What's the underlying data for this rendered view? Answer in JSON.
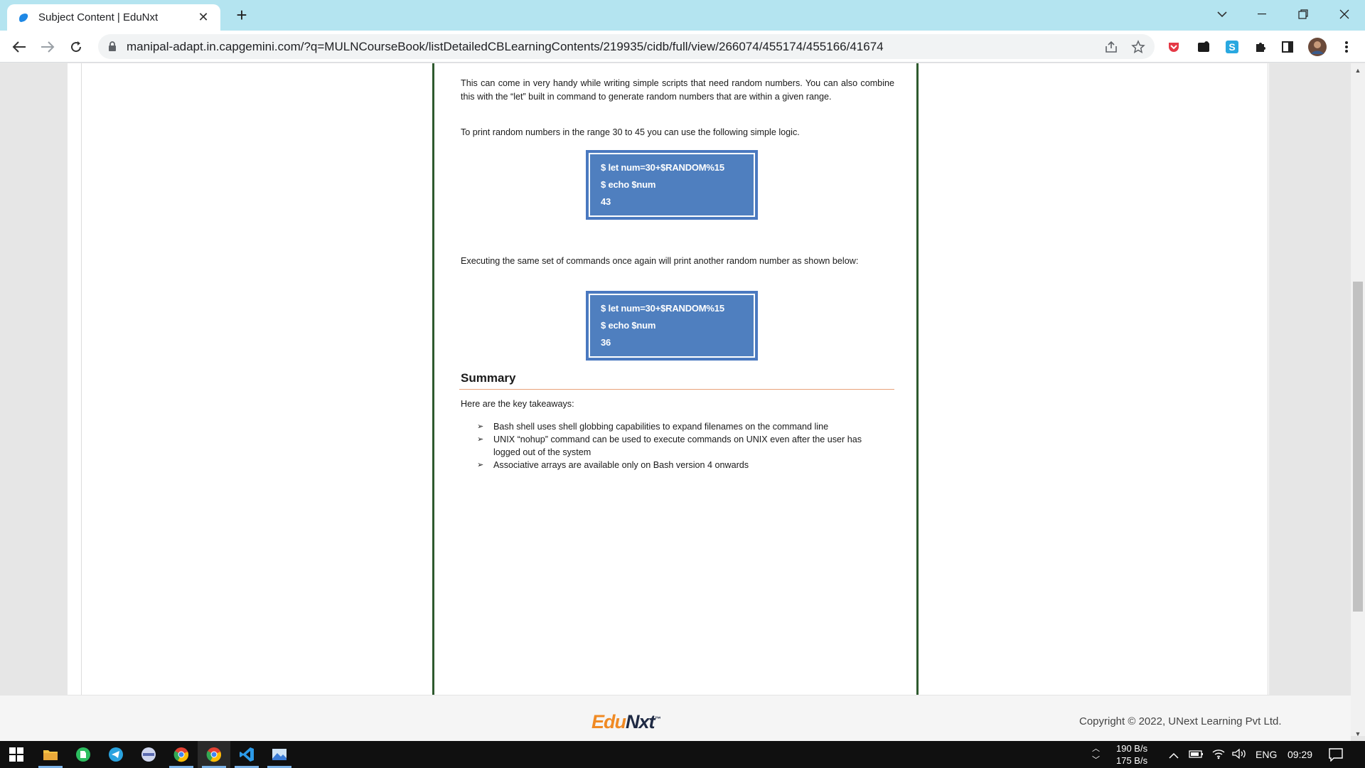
{
  "browser": {
    "tab_title": "Subject Content | EduNxt",
    "url": "manipal-adapt.in.capgemini.com/?q=MULNCourseBook/listDetailedCBLearningContents/219935/cidb/full/view/266074/455174/455166/41674"
  },
  "document": {
    "para1": "This can come in very handy while writing simple scripts that need random numbers. You can also combine this with the “let” built in command to generate random numbers that are within a given range.",
    "para2": "To print random numbers in the range 30 to 45 you can use the following simple logic.",
    "code1": [
      "$ let num=30+$RANDOM%15",
      "$ echo $num",
      "43"
    ],
    "para3": "Executing the same set of commands once again will print another random number as shown below:",
    "code2": [
      "$ let num=30+$RANDOM%15",
      "$ echo $num",
      "36"
    ],
    "summary_heading": "Summary",
    "summary_intro": "Here are the key takeaways:",
    "bullets": [
      "Bash shell uses shell globbing capabilities to expand filenames on the command line",
      "UNIX “nohup” command can be used to execute commands on UNIX even after the user has logged out of the system",
      "Associative arrays are available only on Bash version 4 onwards"
    ],
    "bullet_marker": "➢"
  },
  "footer": {
    "logo_part1": "Edu",
    "logo_part2": "Nxt",
    "logo_tm": "™",
    "copyright": "Copyright © 2022, UNext Learning Pvt Ltd."
  },
  "taskbar": {
    "net_up": "190 B/s",
    "net_down": "175 B/s",
    "language": "ENG",
    "time": "09:29"
  }
}
